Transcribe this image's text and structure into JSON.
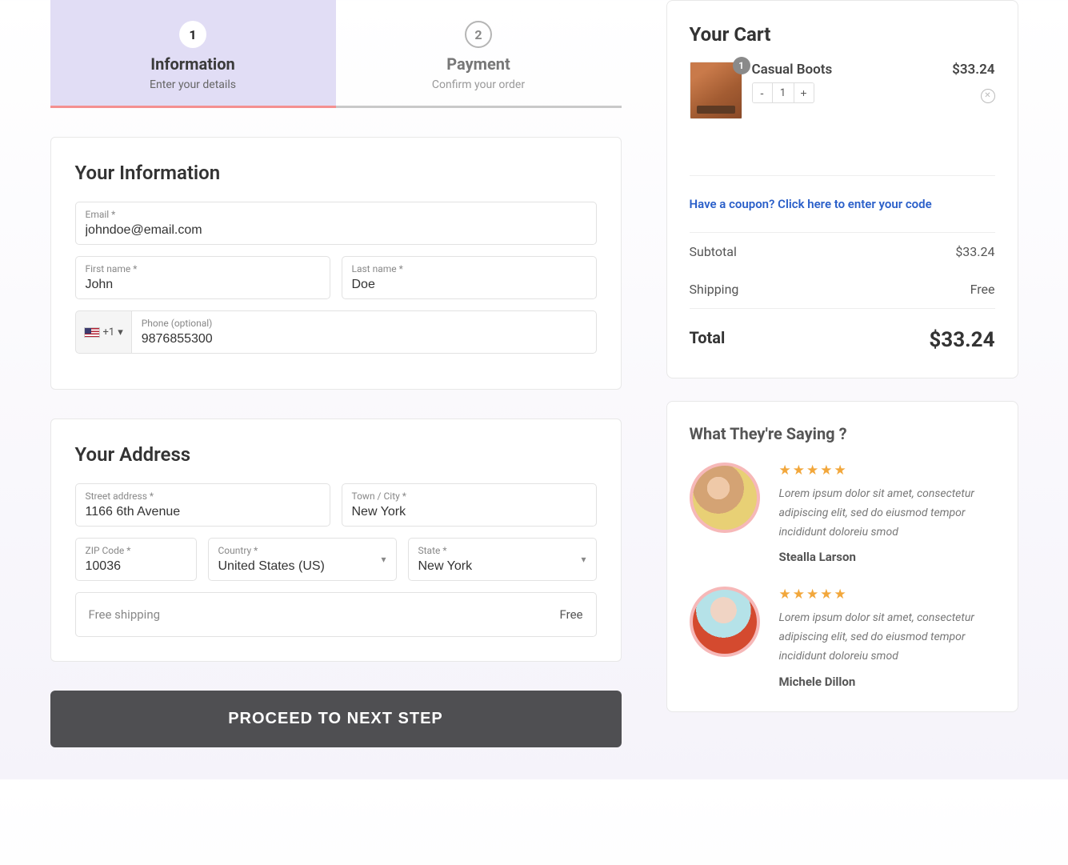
{
  "stepper": {
    "steps": [
      {
        "num": "1",
        "title": "Information",
        "sub": "Enter your details",
        "active": true
      },
      {
        "num": "2",
        "title": "Payment",
        "sub": "Confirm your order",
        "active": false
      }
    ]
  },
  "information": {
    "heading": "Your Information",
    "email_label": "Email *",
    "email_value": "johndoe@email.com",
    "first_name_label": "First name *",
    "first_name_value": "John",
    "last_name_label": "Last name *",
    "last_name_value": "Doe",
    "dial_code": "+1",
    "phone_label": "Phone (optional)",
    "phone_value": "9876855300"
  },
  "address": {
    "heading": "Your Address",
    "street_label": "Street address *",
    "street_value": "1166 6th Avenue",
    "city_label": "Town / City *",
    "city_value": "New York",
    "zip_label": "ZIP Code *",
    "zip_value": "10036",
    "country_label": "Country *",
    "country_value": "United States (US)",
    "state_label": "State *",
    "state_value": "New York",
    "shipping_method": "Free shipping",
    "shipping_cost": "Free"
  },
  "proceed_label": "PROCEED TO NEXT STEP",
  "cart": {
    "heading": "Your Cart",
    "item": {
      "qty_badge": "1",
      "name": "Casual Boots",
      "qty": "1",
      "price": "$33.24"
    },
    "coupon_text": "Have a coupon? Click here to enter your code",
    "subtotal_label": "Subtotal",
    "subtotal_value": "$33.24",
    "shipping_label": "Shipping",
    "shipping_value": "Free",
    "total_label": "Total",
    "total_value": "$33.24"
  },
  "testimonials": {
    "heading": "What They're Saying ?",
    "items": [
      {
        "stars": "★★★★★",
        "text": "Lorem ipsum dolor sit amet, consectetur adipiscing elit, sed do eiusmod tempor incididunt doloreiu smod",
        "name": "Stealla Larson"
      },
      {
        "stars": "★★★★★",
        "text": "Lorem ipsum dolor sit amet, consectetur adipiscing elit, sed do eiusmod tempor incididunt doloreiu smod",
        "name": "Michele Dillon"
      }
    ]
  }
}
